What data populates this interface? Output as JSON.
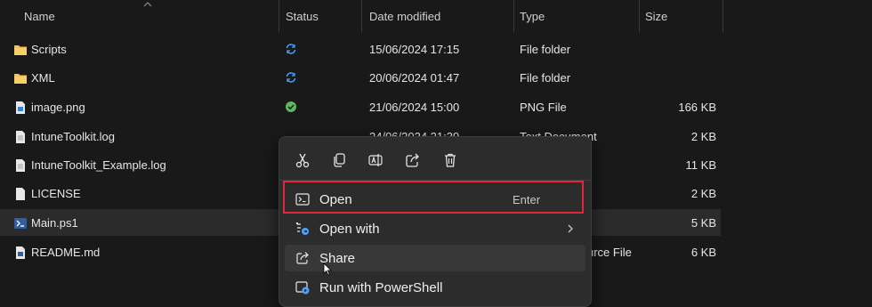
{
  "columns": {
    "name": "Name",
    "status": "Status",
    "date_modified": "Date modified",
    "type": "Type",
    "size": "Size"
  },
  "files": [
    {
      "name": "Scripts",
      "icon": "folder-icon",
      "status": "sync",
      "date": "15/06/2024 17:15",
      "type": "File folder",
      "size": ""
    },
    {
      "name": "XML",
      "icon": "folder-icon",
      "status": "sync",
      "date": "20/06/2024 01:47",
      "type": "File folder",
      "size": ""
    },
    {
      "name": "image.png",
      "icon": "image-file-icon",
      "status": "synced",
      "date": "21/06/2024 15:00",
      "type": "PNG File",
      "size": "166 KB"
    },
    {
      "name": "IntuneToolkit.log",
      "icon": "document-icon",
      "status": "",
      "date": "24/06/2024 21:39",
      "type": "Text Document",
      "size": "2 KB"
    },
    {
      "name": "IntuneToolkit_Example.log",
      "icon": "document-icon",
      "status": "",
      "date": "",
      "type": "",
      "size": "11 KB"
    },
    {
      "name": "LICENSE",
      "icon": "document-icon",
      "status": "",
      "date": "",
      "type": "",
      "size": "2 KB"
    },
    {
      "name": "Main.ps1",
      "icon": "powershell-file-icon",
      "status": "",
      "date": "",
      "type": "",
      "size": "5 KB"
    },
    {
      "name": "README.md",
      "icon": "markdown-file-icon",
      "status": "",
      "date": "",
      "type": "urce File",
      "size": "6 KB"
    }
  ],
  "context_menu": {
    "toolbar": [
      "cut-icon",
      "copy-icon",
      "rename-icon",
      "share-icon",
      "delete-icon"
    ],
    "items": [
      {
        "label": "Open",
        "shortcut": "Enter",
        "icon": "powershell-icon"
      },
      {
        "label": "Open with",
        "shortcut": "",
        "icon": "open-with-icon"
      },
      {
        "label": "Share",
        "shortcut": "",
        "icon": "share-icon"
      },
      {
        "label": "Run with PowerShell",
        "shortcut": "",
        "icon": "run-powershell-icon"
      }
    ]
  },
  "colors": {
    "background": "#191919",
    "selected_row": "#2b2b2b",
    "menu_background": "#2c2c2c",
    "highlight_border": "#e0283a",
    "folder": "#f2c14e",
    "sync_blue": "#4aa3ff",
    "synced_green": "#5cb85c"
  }
}
